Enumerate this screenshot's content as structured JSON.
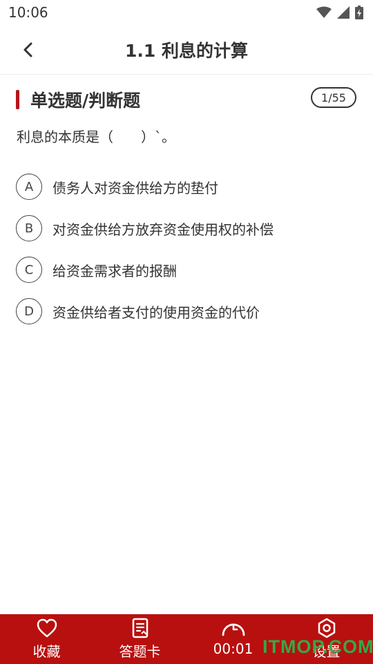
{
  "status_bar": {
    "time": "10:06"
  },
  "header": {
    "title": "1.1 利息的计算"
  },
  "question": {
    "type_label": "单选题/判断题",
    "progress": "1/55",
    "text": "利息的本质是（　　）`。",
    "options": [
      {
        "letter": "A",
        "text": "债务人对资金供给方的垫付"
      },
      {
        "letter": "B",
        "text": "对资金供给方放弃资金使用权的补偿"
      },
      {
        "letter": "C",
        "text": "给资金需求者的报酬"
      },
      {
        "letter": "D",
        "text": "资金供给者支付的使用资金的代价"
      }
    ]
  },
  "bottom_bar": {
    "favorite_label": "收藏",
    "answer_card_label": "答题卡",
    "timer": "00:01",
    "settings_label": "设置"
  },
  "watermark": "ITMOP.COM",
  "colors": {
    "accent": "#b8141b",
    "bottom_bar": "#b8100f",
    "watermark": "#2fb14a"
  }
}
